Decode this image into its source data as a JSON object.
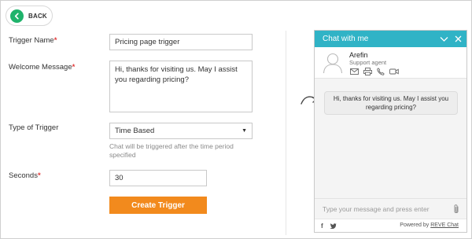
{
  "back": {
    "label": "BACK"
  },
  "form": {
    "trigger_name": {
      "label": "Trigger Name",
      "value": "Pricing page trigger"
    },
    "welcome_message": {
      "label": "Welcome Message",
      "value": "Hi, thanks for visiting us. May I assist you regarding pricing?"
    },
    "trigger_type": {
      "label": "Type of Trigger",
      "value": "Time Based",
      "helper": "Chat will be triggered after the time period specified"
    },
    "seconds": {
      "label": "Seconds",
      "value": "30"
    },
    "required_mark": "*",
    "submit_label": "Create Trigger"
  },
  "chat": {
    "title": "Chat with me",
    "agent_name": "Arefin",
    "agent_role": "Support agent",
    "message": "Hi, thanks for visiting us. May I assist you regarding pricing?",
    "input_placeholder": "Type your message and press enter",
    "powered_by": "Powered by",
    "brand": "REVE Chat",
    "social_f": "f"
  },
  "colors": {
    "accent_green": "#1fb36b",
    "chat_header": "#30b3c6",
    "create_button": "#f28a1d",
    "required": "#e23b3b"
  }
}
